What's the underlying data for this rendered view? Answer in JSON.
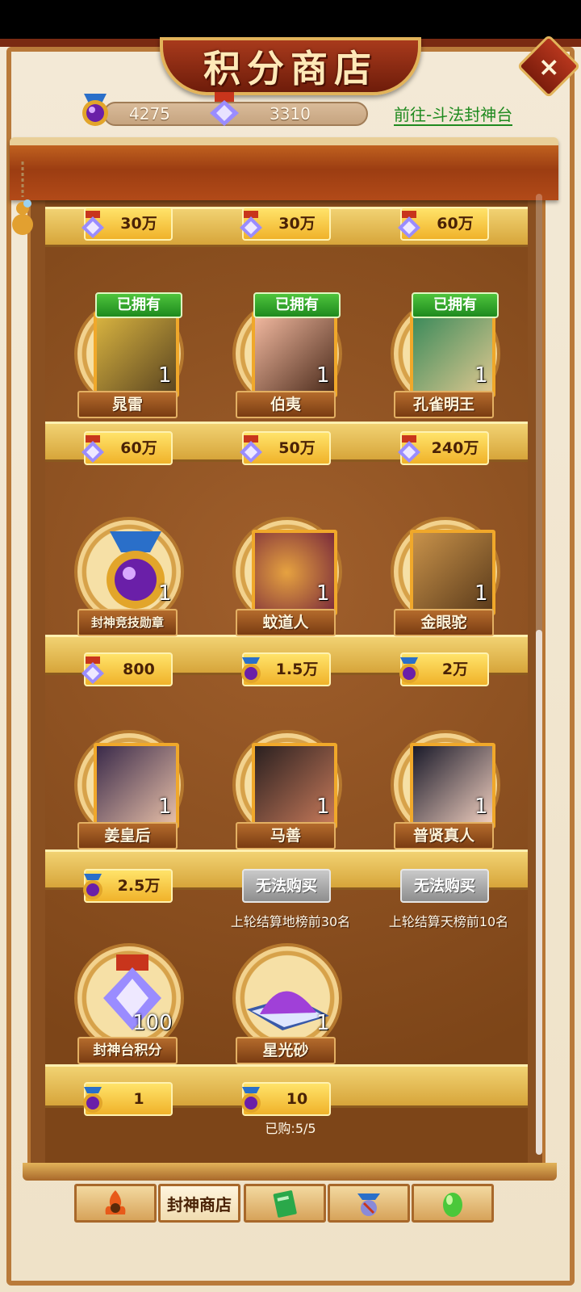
{
  "title": "积分商店",
  "close_label": "×",
  "currencies": {
    "arena_medal": "4275",
    "points": "3310"
  },
  "goto_link": "前往-斗法封神台",
  "top_row_prices": [
    "30万",
    "30万",
    "60万"
  ],
  "rows": [
    {
      "items": [
        {
          "name": "晁雷",
          "owned": "已拥有",
          "qty": "1",
          "price": "60万",
          "currency": "points"
        },
        {
          "name": "伯夷",
          "owned": "已拥有",
          "qty": "1",
          "price": "50万",
          "currency": "points"
        },
        {
          "name": "孔雀明王",
          "owned": "已拥有",
          "qty": "1",
          "price": "240万",
          "currency": "points"
        }
      ]
    },
    {
      "items": [
        {
          "name": "封神竞技勋章",
          "qty": "1",
          "price": "800",
          "currency": "points"
        },
        {
          "name": "蚊道人",
          "qty": "1",
          "price": "1.5万",
          "currency": "arena_medal"
        },
        {
          "name": "金眼驼",
          "qty": "1",
          "price": "2万",
          "currency": "arena_medal"
        }
      ]
    },
    {
      "items": [
        {
          "name": "姜皇后",
          "qty": "1",
          "price": "2.5万",
          "currency": "arena_medal"
        },
        {
          "name": "马善",
          "qty": "1",
          "price": "无法购买",
          "condition": "上轮结算地榜前30名"
        },
        {
          "name": "普贤真人",
          "qty": "1",
          "price": "无法购买",
          "condition": "上轮结算天榜前10名"
        }
      ]
    },
    {
      "items": [
        {
          "name": "封神台积分",
          "qty": "100",
          "price": "1",
          "currency": "arena_medal"
        },
        {
          "name": "星光砂",
          "qty": "1",
          "price": "10",
          "currency": "arena_medal"
        }
      ]
    }
  ],
  "bought": "已购:5/5",
  "tabs": {
    "active_label": "封神商店"
  },
  "colors": {
    "frame": "#7a2a12",
    "shelf": "#e8c058",
    "link": "#1f8a1f",
    "owned": "#2ea12a"
  }
}
